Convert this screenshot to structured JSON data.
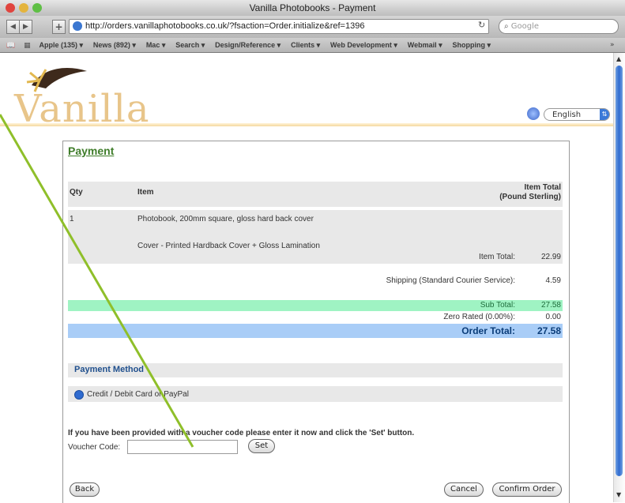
{
  "window": {
    "title": "Vanilla Photobooks - Payment"
  },
  "browser": {
    "url": "http://orders.vanillaphotobooks.co.uk/?fsaction=Order.initialize&ref=1396",
    "search_placeholder": "Google",
    "bookmarks": [
      "Apple (135) ▾",
      "News (892) ▾",
      "Mac ▾",
      "Search ▾",
      "Design/Reference ▾",
      "Clients ▾",
      "Web Development ▾",
      "Webmail ▾",
      "Shopping ▾"
    ]
  },
  "site": {
    "brand": "Vanilla",
    "language": "English"
  },
  "payment": {
    "title": "Payment",
    "table": {
      "headers": {
        "qty": "Qty",
        "item": "Item",
        "item_total_line1": "Item Total",
        "item_total_line2": "(Pound Sterling)"
      },
      "row": {
        "qty": "1",
        "item": "Photobook, 200mm square, gloss hard back cover",
        "option": "Cover - Printed Hardback Cover + Gloss Lamination",
        "item_total_label": "Item Total:",
        "item_total_value": "22.99"
      }
    },
    "shipping": {
      "label": "Shipping (Standard Courier Service):",
      "value": "4.59"
    },
    "sub_total": {
      "label": "Sub Total:",
      "value": "27.58"
    },
    "vat": {
      "label": "Zero Rated (0.00%):",
      "value": "0.00"
    },
    "order_total": {
      "label": "Order Total:",
      "value": "27.58"
    },
    "method": {
      "title": "Payment Method",
      "option": "Credit / Debit Card or PayPal"
    },
    "voucher": {
      "note": "If you have been provided with a voucher code please enter it now and click the 'Set' button.",
      "label": "Voucher Code:",
      "value": "",
      "set_button": "Set"
    },
    "buttons": {
      "back": "Back",
      "cancel": "Cancel",
      "confirm": "Confirm Order"
    }
  }
}
